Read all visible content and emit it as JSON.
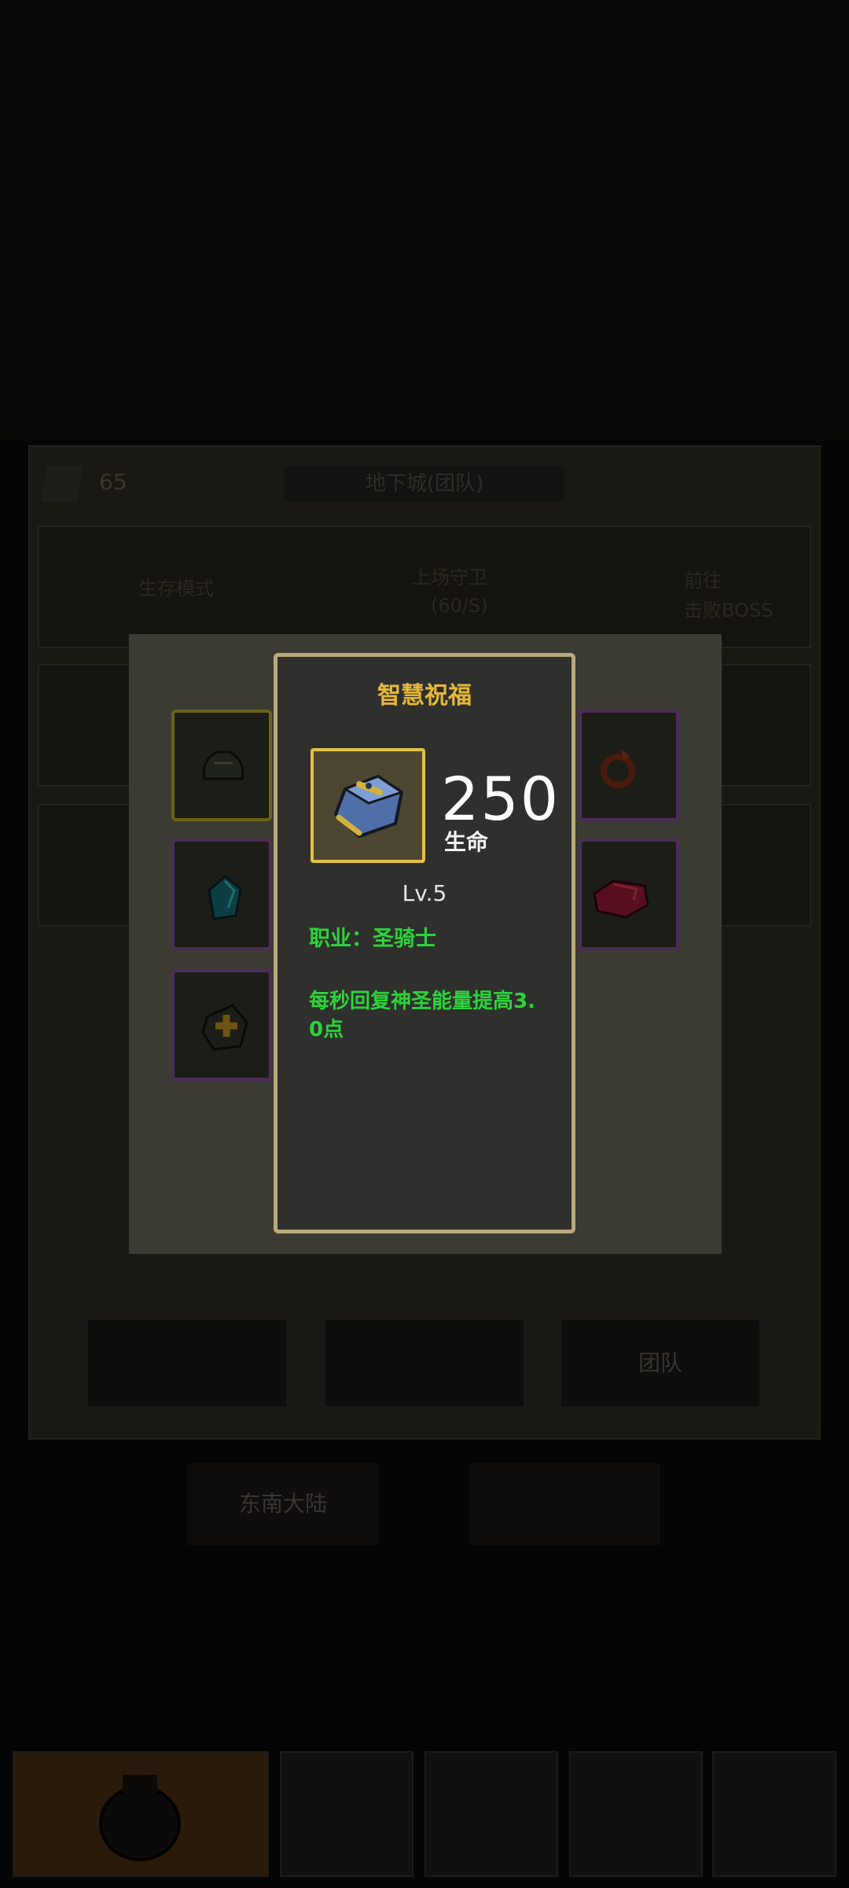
{
  "background": {
    "counter": "65",
    "dungeon_title": "地下城(团队)",
    "row1_left": "生存模式",
    "row1_center_top": "上场守卫",
    "row1_center_bottom": "(60/S)",
    "row1_right_top": "前往",
    "row1_right_bottom": "击败BOSS",
    "team_button": "团队",
    "left_lower_button": "东南大陆"
  },
  "popup": {
    "title": "智慧祝福",
    "stat_value": "250",
    "stat_label": "生命",
    "level": "Lv.5",
    "class_line": "职业：圣骑士",
    "description": "每秒回复神圣能量提高3.0点"
  },
  "colors": {
    "title_gold": "#e6b836",
    "effect_green": "#2cd33a",
    "frame_gold": "#e2c24b",
    "popup_border": "#b9a97b"
  },
  "icons": {
    "item": "blue-gem-icon",
    "slots": [
      "dark-armor-icon",
      "teal-gem-icon",
      "gold-cross-gem-icon",
      "red-ring-icon",
      "red-ruby-icon"
    ]
  }
}
